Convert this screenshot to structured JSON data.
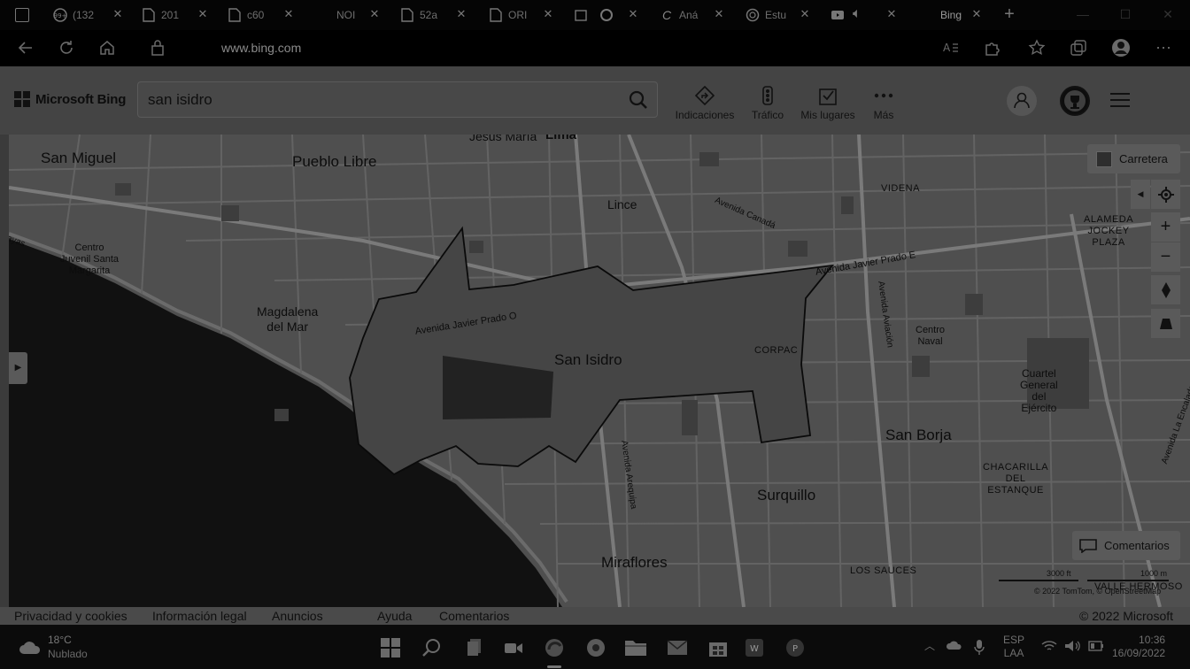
{
  "tabs": [
    {
      "title": "(132",
      "icon": "chat-icon"
    },
    {
      "title": "201",
      "icon": "document-icon"
    },
    {
      "title": "c60",
      "icon": "document-icon"
    },
    {
      "title": "NOI",
      "icon": "blank-icon"
    },
    {
      "title": "52a",
      "icon": "document-icon"
    },
    {
      "title": "ORI",
      "icon": "document-icon"
    },
    {
      "title": "",
      "icon": "media-icon"
    },
    {
      "title": "Aná",
      "icon": "c-logo-icon"
    },
    {
      "title": "Estu",
      "icon": "circle-icon"
    },
    {
      "title": "",
      "icon": "audio-icon"
    },
    {
      "title": "Bing",
      "icon": "bing-icon"
    }
  ],
  "address_bar": {
    "url": "www.bing.com"
  },
  "bing": {
    "brand": "Microsoft Bing",
    "search_value": "san isidro",
    "nav": [
      {
        "label": "Indicaciones",
        "icon": "directions-icon"
      },
      {
        "label": "Tráfico",
        "icon": "traffic-icon"
      },
      {
        "label": "Mis lugares",
        "icon": "my-places-icon"
      },
      {
        "label": "Más",
        "icon": "more-dots-icon"
      }
    ]
  },
  "map": {
    "map_type_label": "Carretera",
    "feedback_label": "Comentarios",
    "scale_ft": "3000 ft",
    "scale_m": "1000 m",
    "copyright": "© 2022 TomTom, © OpenStreetMap",
    "labels": {
      "san_miguel": "San Miguel",
      "jesus_maria": "Jesús María",
      "lima": "Lima",
      "pueblo_libre": "Pueblo Libre",
      "lince": "Lince",
      "videna": "VIDENA",
      "avenida_canada": "Avenida Canadá",
      "alameda_1": "ALAMEDA",
      "alameda_2": "JOCKEY",
      "alameda_3": "PLAZA",
      "ayas": "ayas",
      "centro_juvenil_1": "Centro",
      "centro_juvenil_2": "Juvenil Santa",
      "centro_juvenil_3": "Margarita",
      "prado_e": "Avenida Javier Prado E",
      "prado_o": "Avenida Javier Prado O",
      "magdalena_1": "Magdalena",
      "magdalena_2": "del Mar",
      "san_isidro": "San Isidro",
      "corpac": "CORPAC",
      "av_aviacion": "Avenida Aviación",
      "centro_naval_1": "Centro",
      "centro_naval_2": "Naval",
      "cuartel_1": "Cuartel",
      "cuartel_2": "General",
      "cuartel_3": "del",
      "cuartel_4": "Ejército",
      "san_borja": "San Borja",
      "av_arequipa": "Avenida Arequipa",
      "av_encalada": "Avenida La Encalada",
      "chacarilla_1": "CHACARILLA",
      "chacarilla_2": "DEL",
      "chacarilla_3": "ESTANQUE",
      "surquillo": "Surquillo",
      "miraflores": "Miraflores",
      "los_sauces": "LOS SAUCES",
      "valle_hermoso": "VALLE HERMOSO"
    }
  },
  "footer": {
    "links": [
      "Privacidad y cookies",
      "Información legal",
      "Anuncios",
      "Ayuda",
      "Comentarios"
    ],
    "copyright": "© 2022 Microsoft"
  },
  "taskbar": {
    "temperature": "18°C",
    "condition": "Nublado",
    "lang_1": "ESP",
    "lang_2": "LAA",
    "time": "10:36",
    "date": "16/09/2022"
  }
}
